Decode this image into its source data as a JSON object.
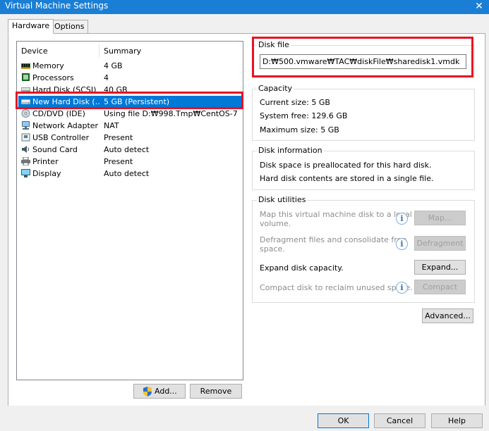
{
  "window": {
    "title": "Virtual Machine Settings",
    "close_glyph": "✕"
  },
  "tabs": [
    {
      "label": "Hardware"
    },
    {
      "label": "Options"
    }
  ],
  "device_list": {
    "col_device": "Device",
    "col_summary": "Summary",
    "rows": [
      {
        "device": "Memory",
        "summary": "4 GB",
        "icon": "memory-icon"
      },
      {
        "device": "Processors",
        "summary": "4",
        "icon": "processor-icon"
      },
      {
        "device": "Hard Disk (SCSI)",
        "summary": "40 GB",
        "icon": "hard-disk-icon"
      },
      {
        "device": "New Hard Disk (...",
        "summary": "5 GB (Persistent)",
        "icon": "hard-disk-icon",
        "selected": true
      },
      {
        "device": "CD/DVD (IDE)",
        "summary": "Using file D:₩998.Tmp₩CentOS-7-...",
        "icon": "cd-dvd-icon"
      },
      {
        "device": "Network Adapter",
        "summary": "NAT",
        "icon": "network-adapter-icon"
      },
      {
        "device": "USB Controller",
        "summary": "Present",
        "icon": "usb-icon"
      },
      {
        "device": "Sound Card",
        "summary": "Auto detect",
        "icon": "sound-card-icon"
      },
      {
        "device": "Printer",
        "summary": "Present",
        "icon": "printer-icon"
      },
      {
        "device": "Display",
        "summary": "Auto detect",
        "icon": "display-icon"
      }
    ]
  },
  "buttons": {
    "add": "Add...",
    "remove": "Remove",
    "ok": "OK",
    "cancel": "Cancel",
    "help": "Help",
    "advanced": "Advanced..."
  },
  "disk_file": {
    "legend": "Disk file",
    "path": "D:₩500.vmware₩TAC₩diskFile₩sharedisk1.vmdk"
  },
  "capacity": {
    "legend": "Capacity",
    "current_size": "Current size:  5 GB",
    "system_free": "System free:  129.6 GB",
    "maximum_size": "Maximum size:  5 GB"
  },
  "disk_information": {
    "legend": "Disk information",
    "line1": "Disk space is preallocated for this hard disk.",
    "line2": "Hard disk contents are stored in a single file."
  },
  "disk_utilities": {
    "legend": "Disk utilities",
    "map_text_1": "Map this virtual machine disk to a local",
    "map_text_2": "volume.",
    "map_button": "Map...",
    "defrag_text_1": "Defragment files and consolidate free",
    "defrag_text_2": "space.",
    "defrag_button": "Defragment",
    "expand_text": "Expand disk capacity.",
    "expand_button": "Expand...",
    "compact_text": "Compact disk to reclaim unused space.",
    "compact_button": "Compact",
    "info_glyph": "i"
  },
  "colors": {
    "title_bar": "#1a7fd4",
    "selection": "#0078d7",
    "highlight_box": "#e81123"
  }
}
